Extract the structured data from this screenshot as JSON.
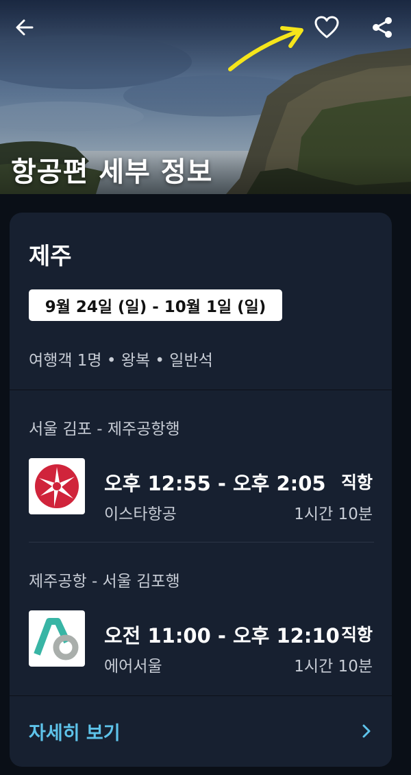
{
  "header": {
    "title": "항공편 세부 정보",
    "back_icon": "arrow-left-icon",
    "favorite_icon": "heart-outline-icon",
    "share_icon": "share-icon",
    "annotation_color": "#f5e51b"
  },
  "trip": {
    "destination": "제주",
    "dates": "9월 24일 (일) - 10월 1일 (일)",
    "summary": "여행객 1명 • 왕복 • 일반석"
  },
  "flights": [
    {
      "route": "서울 김포 - 제주공항행",
      "times": "오후 12:55 - 오후 2:05",
      "stops": "직항",
      "airline": "이스타항공",
      "duration": "1시간 10분",
      "logo_icon": "eastar-jet-logo",
      "logo_color": "#d0243b"
    },
    {
      "route": "제주공항 - 서울 김포행",
      "times": "오전 11:00 - 오후 12:10",
      "stops": "직항",
      "airline": "에어서울",
      "duration": "1시간 10분",
      "logo_icon": "air-seoul-logo",
      "logo_color": "#38b5a5"
    }
  ],
  "footer": {
    "details_label": "자세히 보기",
    "chevron_icon": "chevron-right-icon",
    "accent_color": "#5ec3ea"
  }
}
